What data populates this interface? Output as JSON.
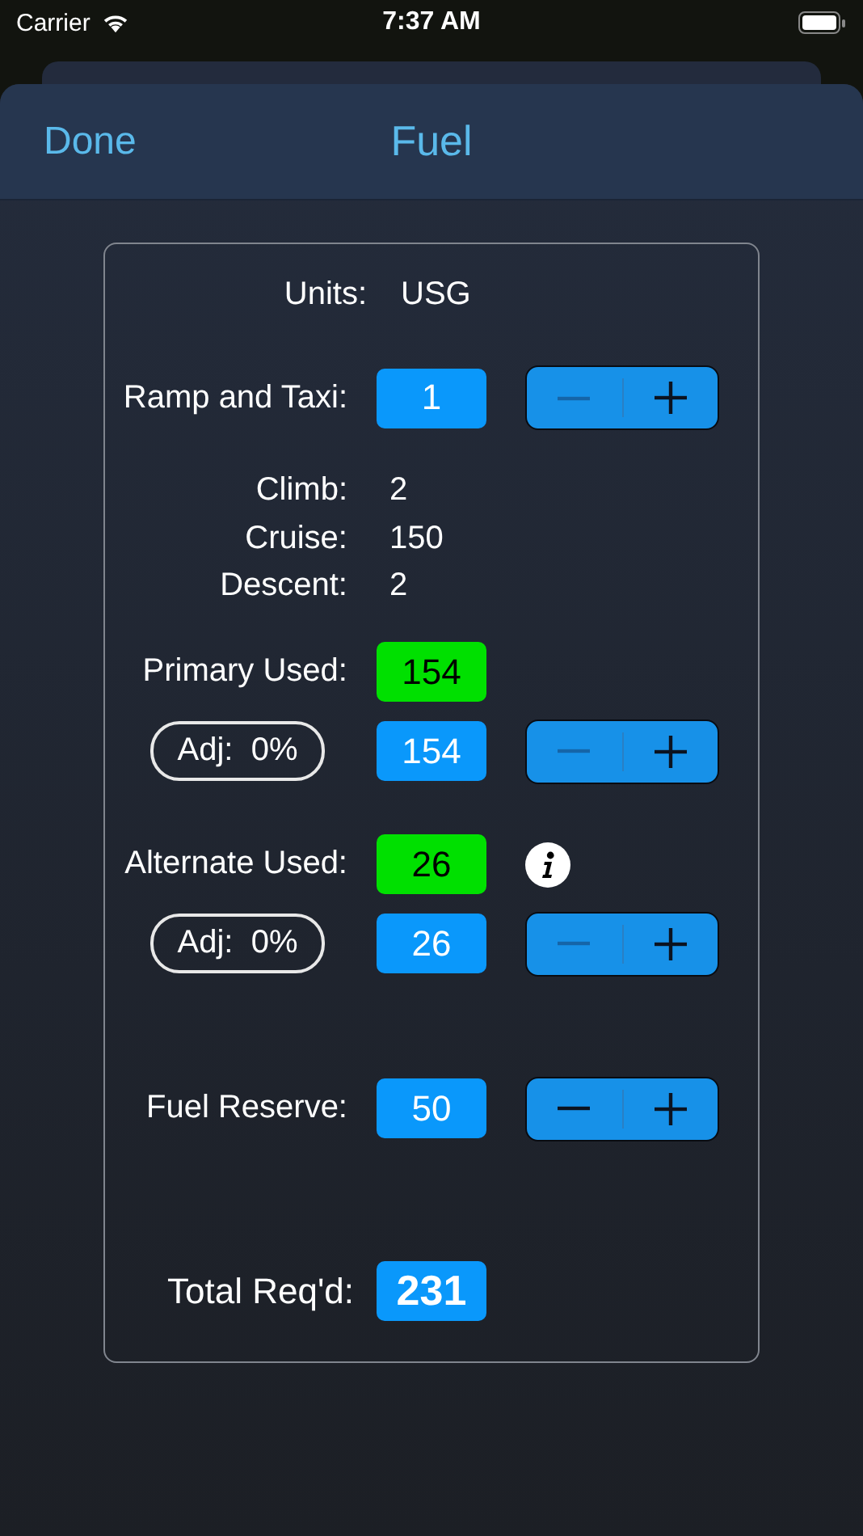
{
  "status_bar": {
    "carrier": "Carrier",
    "time": "7:37 AM"
  },
  "nav": {
    "left_button": "Done",
    "title": "Fuel"
  },
  "rows": [
    {
      "kind": "units",
      "label": "Units:",
      "value": "USG"
    },
    {
      "kind": "stepper",
      "label": "Ramp and Taxi:",
      "value": "1",
      "minus_disabled": true
    },
    {
      "kind": "breakdown",
      "items": [
        {
          "label": "Climb:",
          "value": "2"
        },
        {
          "label": "Cruise:",
          "value": "150"
        },
        {
          "label": "Descent:",
          "value": "2"
        }
      ]
    },
    {
      "kind": "used",
      "label": "Primary Used:",
      "value": "154",
      "info": false
    },
    {
      "kind": "adjust",
      "adj": "Adj:  0%",
      "value": "154",
      "minus_disabled": true
    },
    {
      "kind": "used",
      "label": "Alternate Used:",
      "value": "26",
      "info": true
    },
    {
      "kind": "adjust",
      "adj": "Adj:  0%",
      "value": "26",
      "minus_disabled": true
    },
    {
      "kind": "stepper",
      "label": "Fuel Reserve:",
      "value": "50",
      "minus_disabled": false
    },
    {
      "kind": "total",
      "label": "Total Req'd:",
      "value": "231"
    }
  ]
}
